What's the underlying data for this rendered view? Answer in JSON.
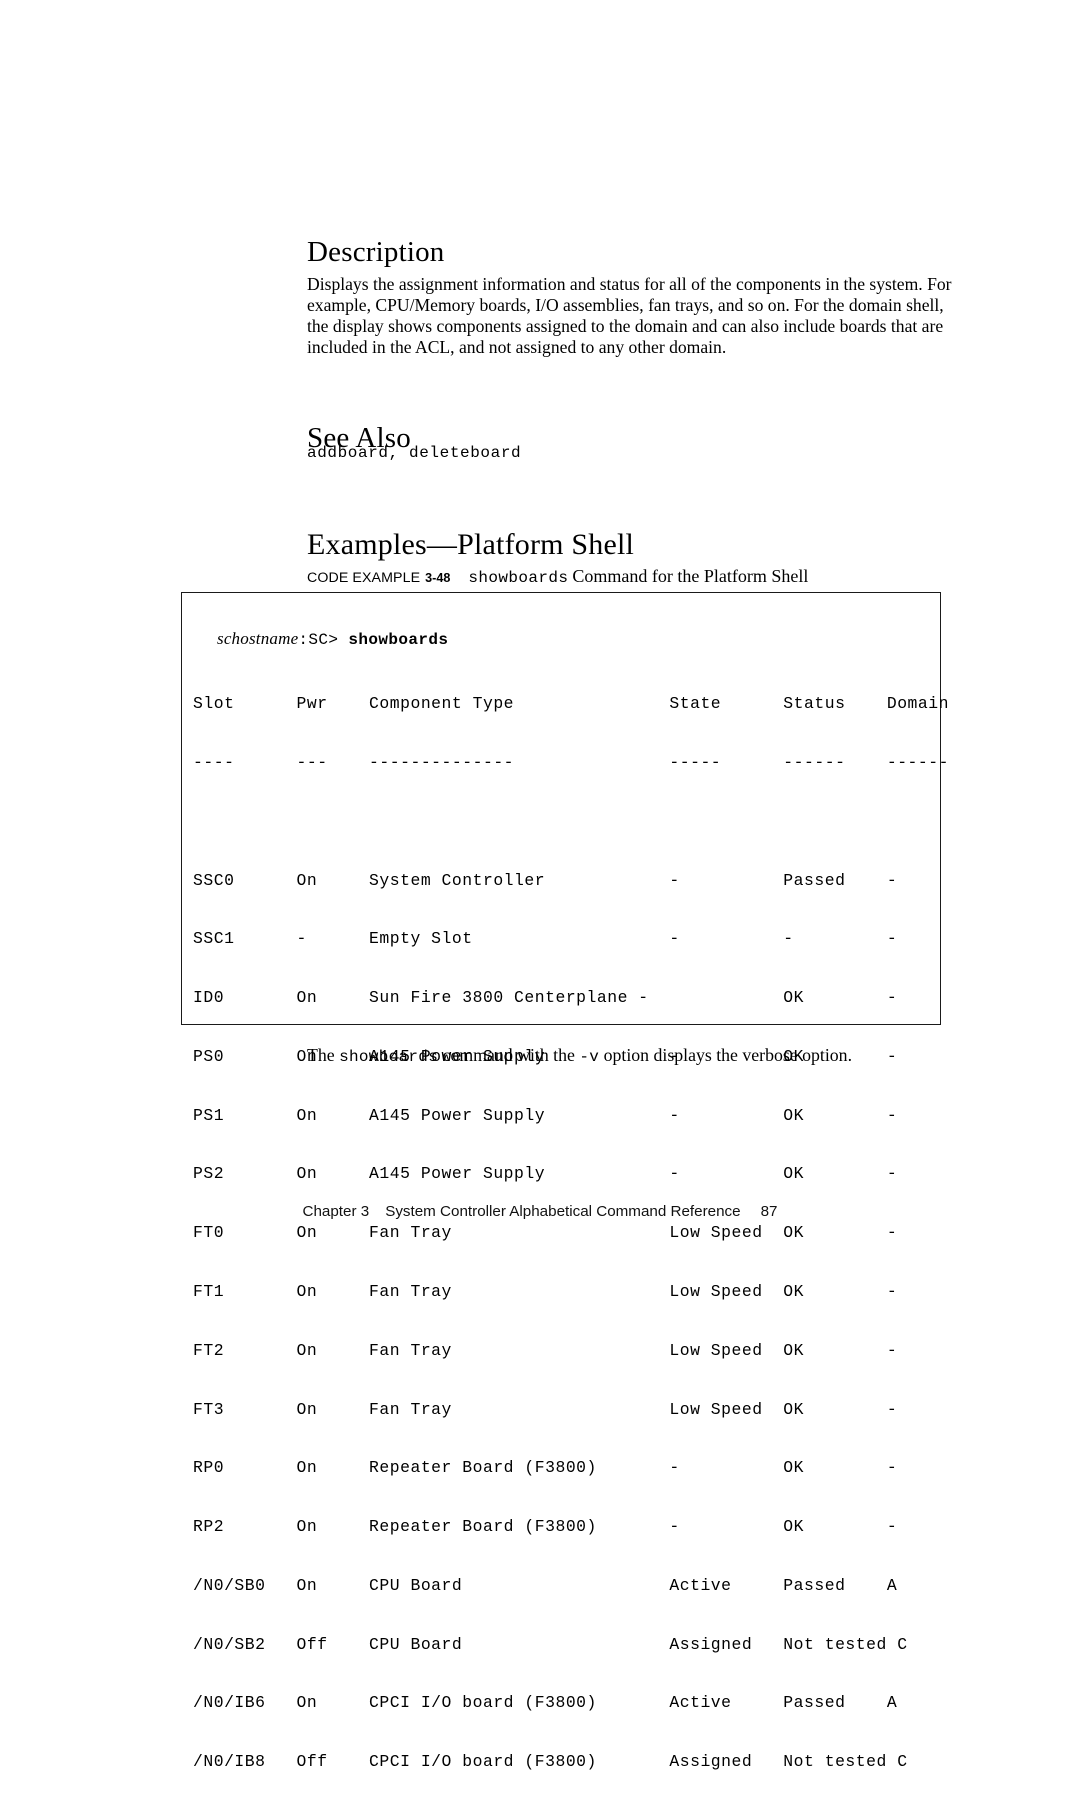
{
  "sections": {
    "description": {
      "heading": "Description",
      "paragraph": "Displays the assignment information and status for all of the components in the system. For example, CPU/Memory boards, I/O assemblies, fan trays, and so on. For the domain shell, the display shows components assigned to the domain and can also include boards that are included in the ACL, and not assigned to any other domain."
    },
    "see_also": {
      "heading": "See Also",
      "commands": "addboard, deleteboard"
    },
    "examples": {
      "heading": "Examples—Platform Shell"
    }
  },
  "code_example": {
    "caption_label": "CODE EXAMPLE",
    "caption_number": "3-48",
    "caption_command": "showboards",
    "caption_rest": "Command for the Platform Shell",
    "prompt": {
      "hostname": "schostname",
      "sc": ":SC>",
      "command": "showboards"
    },
    "columns": [
      "Slot",
      "Pwr",
      "Component Type",
      "State",
      "Status",
      "Domain"
    ],
    "rule": [
      "----",
      "---",
      "--------------",
      "-----",
      "------",
      "------"
    ],
    "header_line": "Slot      Pwr    Component Type               State      Status    Domain",
    "rule_line": "----      ---    --------------               -----      ------    ------",
    "rows": [
      {
        "line": "SSC0      On     System Controller            -          Passed    -",
        "slot": "SSC0",
        "pwr": "On",
        "type": "System Controller",
        "state": "-",
        "status": "Passed",
        "domain": "-"
      },
      {
        "line": "SSC1      -      Empty Slot                   -          -         -",
        "slot": "SSC1",
        "pwr": "-",
        "type": "Empty Slot",
        "state": "-",
        "status": "-",
        "domain": "-"
      },
      {
        "line": "ID0       On     Sun Fire 3800 Centerplane -             OK        -",
        "slot": "ID0",
        "pwr": "On",
        "type": "Sun Fire 3800 Centerplane",
        "state": "-",
        "status": "OK",
        "domain": "-"
      },
      {
        "line": "PS0       On     A145 Power Supply            -          OK        -",
        "slot": "PS0",
        "pwr": "On",
        "type": "A145 Power Supply",
        "state": "-",
        "status": "OK",
        "domain": "-"
      },
      {
        "line": "PS1       On     A145 Power Supply            -          OK        -",
        "slot": "PS1",
        "pwr": "On",
        "type": "A145 Power Supply",
        "state": "-",
        "status": "OK",
        "domain": "-"
      },
      {
        "line": "PS2       On     A145 Power Supply            -          OK        -",
        "slot": "PS2",
        "pwr": "On",
        "type": "A145 Power Supply",
        "state": "-",
        "status": "OK",
        "domain": "-"
      },
      {
        "line": "FT0       On     Fan Tray                     Low Speed  OK        -",
        "slot": "FT0",
        "pwr": "On",
        "type": "Fan Tray",
        "state": "Low Speed",
        "status": "OK",
        "domain": "-"
      },
      {
        "line": "FT1       On     Fan Tray                     Low Speed  OK        -",
        "slot": "FT1",
        "pwr": "On",
        "type": "Fan Tray",
        "state": "Low Speed",
        "status": "OK",
        "domain": "-"
      },
      {
        "line": "FT2       On     Fan Tray                     Low Speed  OK        -",
        "slot": "FT2",
        "pwr": "On",
        "type": "Fan Tray",
        "state": "Low Speed",
        "status": "OK",
        "domain": "-"
      },
      {
        "line": "FT3       On     Fan Tray                     Low Speed  OK        -",
        "slot": "FT3",
        "pwr": "On",
        "type": "Fan Tray",
        "state": "Low Speed",
        "status": "OK",
        "domain": "-"
      },
      {
        "line": "RP0       On     Repeater Board (F3800)       -          OK        -",
        "slot": "RP0",
        "pwr": "On",
        "type": "Repeater Board (F3800)",
        "state": "-",
        "status": "OK",
        "domain": "-"
      },
      {
        "line": "RP2       On     Repeater Board (F3800)       -          OK        -",
        "slot": "RP2",
        "pwr": "On",
        "type": "Repeater Board (F3800)",
        "state": "-",
        "status": "OK",
        "domain": "-"
      },
      {
        "line": "/N0/SB0   On     CPU Board                    Active     Passed    A",
        "slot": "/N0/SB0",
        "pwr": "On",
        "type": "CPU Board",
        "state": "Active",
        "status": "Passed",
        "domain": "A"
      },
      {
        "line": "/N0/SB2   Off    CPU Board                    Assigned   Not tested C",
        "slot": "/N0/SB2",
        "pwr": "Off",
        "type": "CPU Board",
        "state": "Assigned",
        "status": "Not tested",
        "domain": "C"
      },
      {
        "line": "/N0/IB6   On     CPCI I/O board (F3800)       Active     Passed    A",
        "slot": "/N0/IB6",
        "pwr": "On",
        "type": "CPCI I/O board (F3800)",
        "state": "Active",
        "status": "Passed",
        "domain": "A"
      },
      {
        "line": "/N0/IB8   Off    CPCI I/O board (F3800)       Assigned   Not tested C",
        "slot": "/N0/IB8",
        "pwr": "Off",
        "type": "CPCI I/O board (F3800)",
        "state": "Assigned",
        "status": "Not tested",
        "domain": "C"
      }
    ]
  },
  "trailing": {
    "before": "The ",
    "mono_command": "showboards",
    "middle": " command with the ",
    "mono_option": "-v",
    "after": " option displays the verbose option."
  },
  "footer": {
    "chapter": "Chapter 3",
    "title": "System Controller Alphabetical Command Reference",
    "page_number": "87"
  }
}
